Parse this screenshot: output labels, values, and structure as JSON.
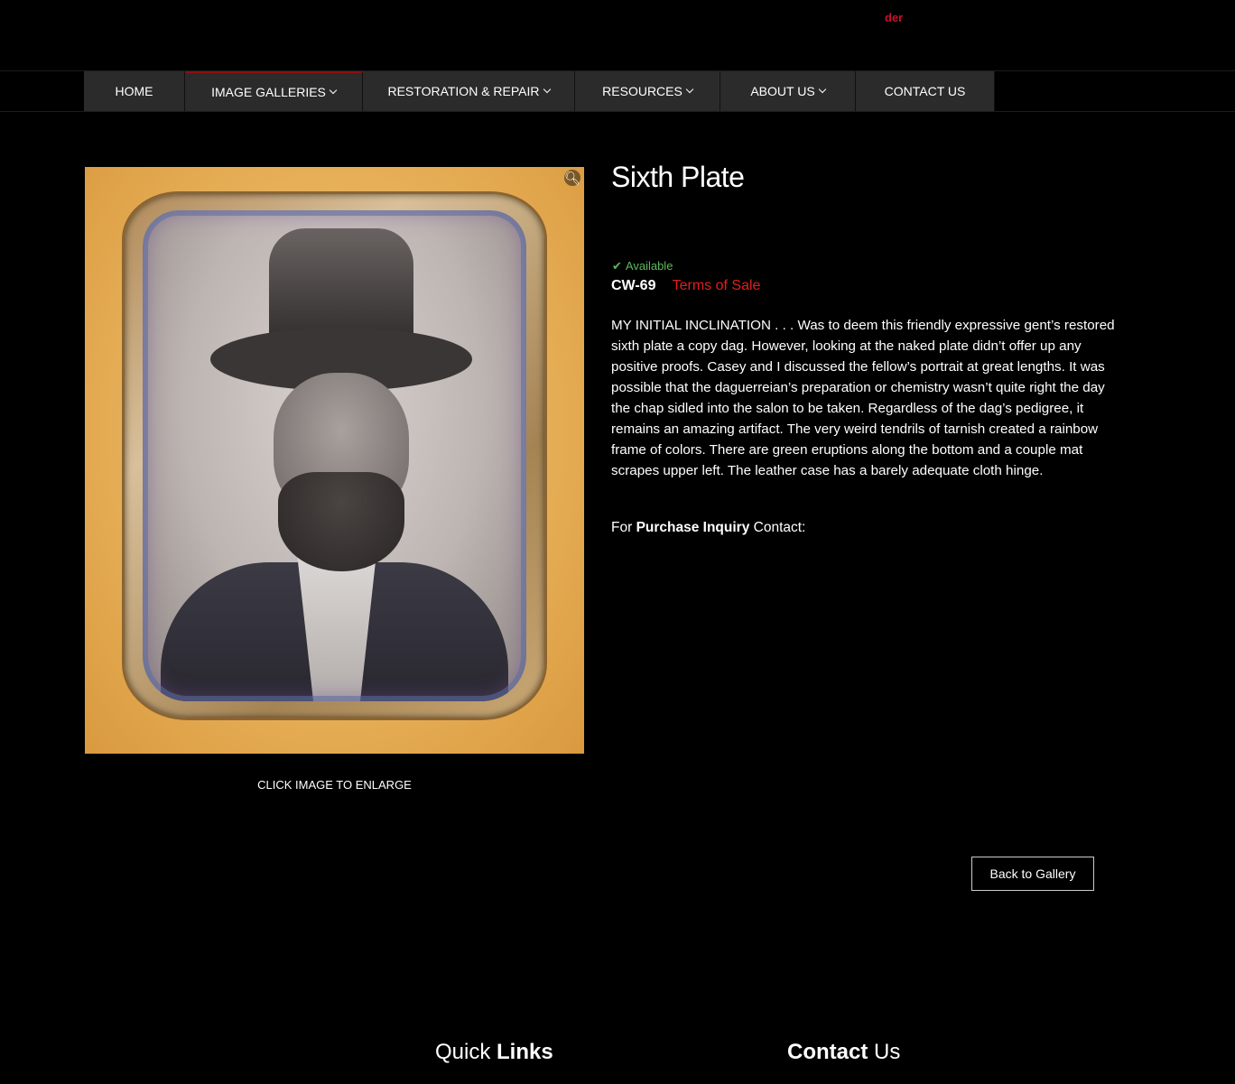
{
  "header": {
    "red_text": "der"
  },
  "nav": {
    "items": [
      {
        "label": "HOME",
        "has_dropdown": false
      },
      {
        "label": "IMAGE GALLERIES",
        "has_dropdown": true
      },
      {
        "label": "RESTORATION & REPAIR",
        "has_dropdown": true
      },
      {
        "label": "RESOURCES",
        "has_dropdown": true
      },
      {
        "label": "ABOUT US",
        "has_dropdown": true
      },
      {
        "label": "CONTACT US",
        "has_dropdown": false
      }
    ],
    "active_index": 1
  },
  "product": {
    "image_caption": "CLICK IMAGE TO ENLARGE",
    "zoom_icon": "magnifier-icon",
    "title": "Sixth Plate",
    "availability": "Available",
    "availability_color": "#5cb85c",
    "sku": "CW-69",
    "terms_label": "Terms of Sale",
    "terms_color": "#e0201c",
    "description": "MY INITIAL INCLINATION . . . Was to deem this friendly expressive gent’s restored sixth plate a copy dag. However, looking at the naked plate didn’t offer up any positive proofs. Casey and I discussed the fellow’s portrait at great lengths. It was possible that the daguerreian’s preparation or chemistry wasn’t quite right the day the chap sidled into the salon to be taken. Regardless of the dag’s pedigree, it remains an amazing artifact. The very weird tendrils of tarnish created a rainbow frame of colors. There are green eruptions along the bottom and a couple mat scrapes upper left. The leather case has a barely adequate cloth hinge.",
    "purchase_prefix": "For ",
    "purchase_bold": "Purchase Inquiry",
    "purchase_suffix": " Contact:",
    "back_button": "Back to Gallery"
  },
  "footer": {
    "quick_links_light": "Quick ",
    "quick_links_bold": "Links",
    "contact_bold": "Contact",
    "contact_light": " Us"
  }
}
